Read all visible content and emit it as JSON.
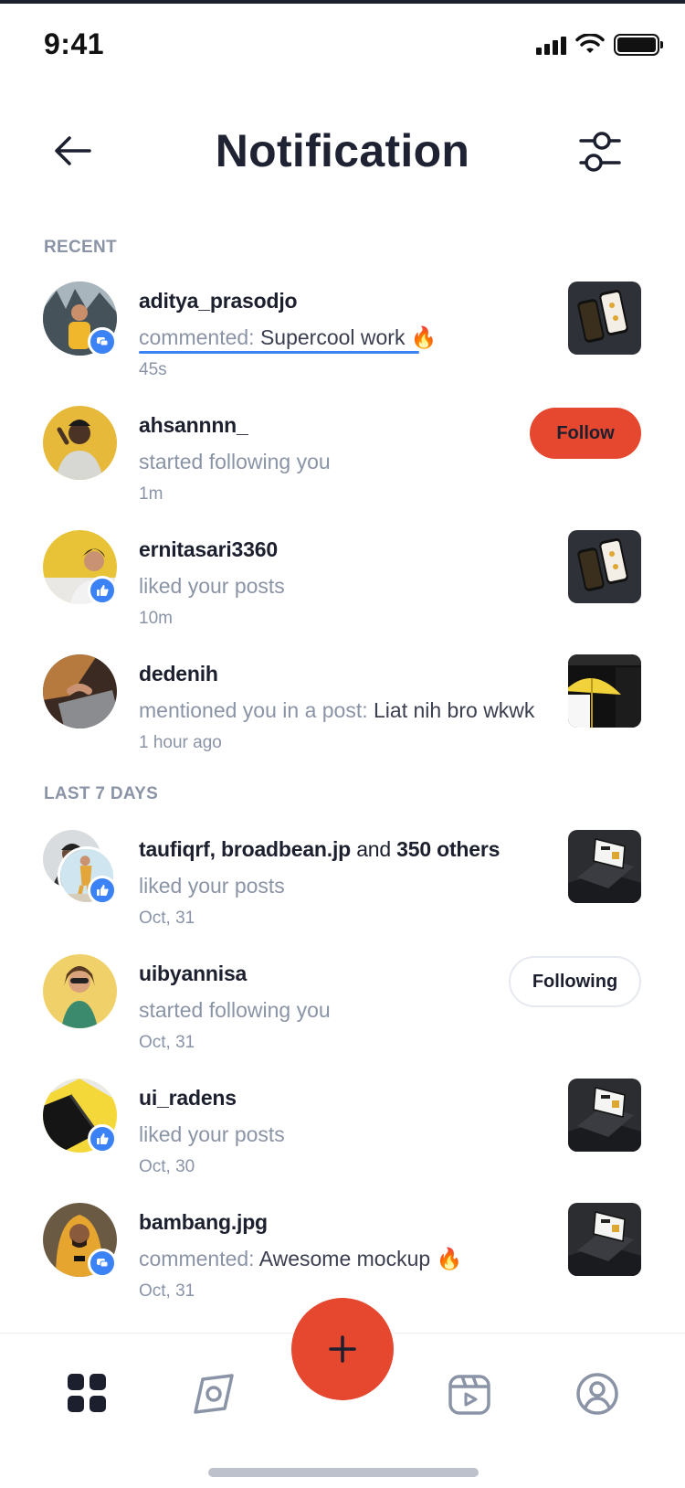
{
  "status_bar": {
    "time": "9:41"
  },
  "header": {
    "title": "Notification"
  },
  "sections": {
    "recent": "RECENT",
    "last7": "LAST 7 DAYS"
  },
  "notifications": [
    {
      "user": "aditya_prasodjo",
      "action": "commented: ",
      "detail": "Supercool work 🔥",
      "time": "45s",
      "badge": "comment-icon"
    },
    {
      "user": "ahsannnn_",
      "action": "started following you",
      "time": "1m",
      "button": "Follow"
    },
    {
      "user": "ernitasari3360",
      "action": "liked your posts",
      "time": "10m",
      "badge": "like-icon"
    },
    {
      "user": "dedenih",
      "action": "mentioned you in a post: ",
      "detail": "Liat nih bro wkwk",
      "time": "1 hour ago"
    },
    {
      "user": "taufiqrf, broadbean.jp",
      "user_joiner": " and ",
      "user_extra": "350 others",
      "action": "liked your posts",
      "time": "Oct, 31",
      "badge": "like-icon"
    },
    {
      "user": "uibyannisa",
      "action": "started following you",
      "time": "Oct, 31",
      "button": "Following"
    },
    {
      "user": "ui_radens",
      "action": "liked your posts",
      "time": "Oct, 30",
      "badge": "like-icon"
    },
    {
      "user": "bambang.jpg",
      "action": "commented: ",
      "detail": "Awesome mockup 🔥",
      "time": "Oct, 31",
      "badge": "comment-icon"
    }
  ],
  "bottom_nav": {
    "items": [
      "dashboard-icon",
      "explore-icon",
      "add-icon",
      "reels-icon",
      "profile-icon"
    ]
  },
  "colors": {
    "accent": "#e5472f",
    "badge": "#3b82f6",
    "muted": "#8a94a6",
    "text": "#1c1f2e"
  }
}
